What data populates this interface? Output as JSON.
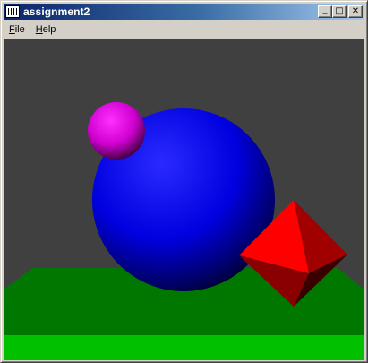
{
  "window": {
    "title": "assignment2",
    "controls": {
      "minimize": "_",
      "maximize": "□",
      "close": "✕"
    }
  },
  "menu": {
    "items": [
      {
        "accel": "F",
        "rest": "ile"
      },
      {
        "accel": "H",
        "rest": "elp"
      }
    ]
  },
  "scene": {
    "background_color": "#404040",
    "objects": [
      "magenta-sphere",
      "blue-sphere",
      "red-octahedron",
      "green-floor"
    ],
    "colors": {
      "floor_dark": "#007a00",
      "floor_light": "#00c000",
      "blue_sphere": "#0000ff",
      "magenta_sphere": "#e600e6",
      "octahedron": "#e00000"
    }
  }
}
